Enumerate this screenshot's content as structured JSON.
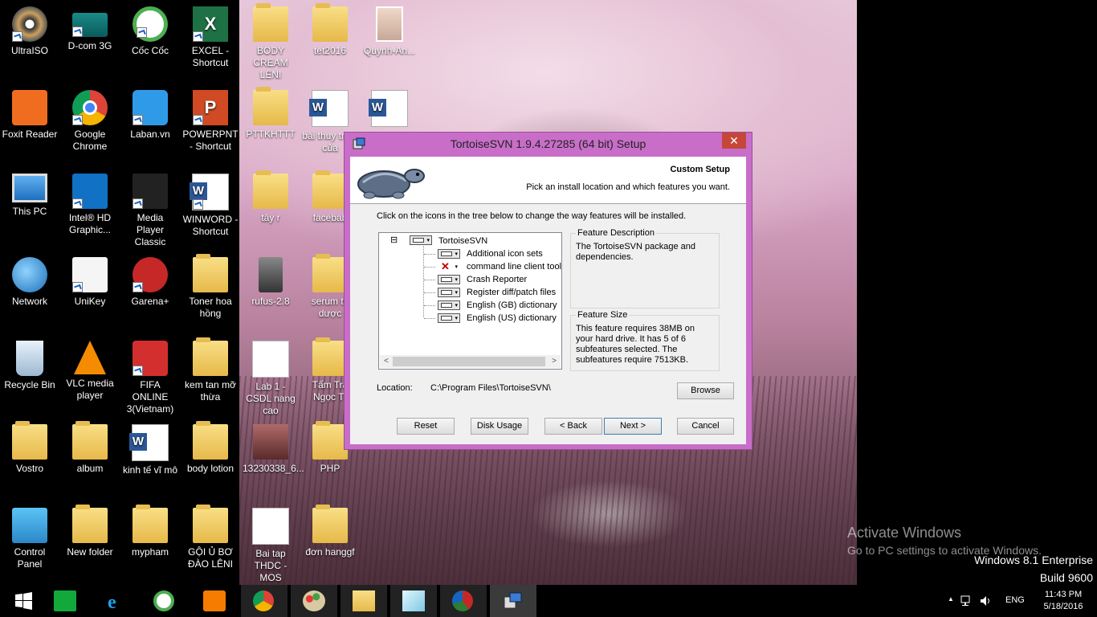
{
  "desktop_icons": [
    {
      "label": "UltraISO"
    },
    {
      "label": "D-com 3G"
    },
    {
      "label": "Cốc Cốc"
    },
    {
      "label": "EXCEL - Shortcut"
    },
    {
      "label": "BODY CREAM LÊNI"
    },
    {
      "label": "tet2016"
    },
    {
      "label": "Quynh-An..."
    },
    {
      "label": "Foxit Reader"
    },
    {
      "label": "Google Chrome"
    },
    {
      "label": "Laban.vn"
    },
    {
      "label": "POWERPNT - Shortcut"
    },
    {
      "label": "PTTKHTTT"
    },
    {
      "label": "bài thuy trình của"
    },
    {
      "label": ""
    },
    {
      "label": "This PC"
    },
    {
      "label": "Intel® HD Graphic..."
    },
    {
      "label": "Media Player Classic"
    },
    {
      "label": "WINWORD - Shortcut"
    },
    {
      "label": "tây r"
    },
    {
      "label": "facebab"
    },
    {
      "label": "Network"
    },
    {
      "label": "UniKey"
    },
    {
      "label": "Garena+"
    },
    {
      "label": "Toner hoa hồng"
    },
    {
      "label": "rufus-2.8"
    },
    {
      "label": "serum th dược"
    },
    {
      "label": "Recycle Bin"
    },
    {
      "label": "VLC media player"
    },
    {
      "label": "FIFA ONLINE 3(Vietnam)"
    },
    {
      "label": "kem tan mỡ thừa"
    },
    {
      "label": "Lab 1 - CSDL nang cao"
    },
    {
      "label": "Tấm Trả Ngọc Tr"
    },
    {
      "label": "Vostro"
    },
    {
      "label": "album"
    },
    {
      "label": "kinh tế vĩ mô"
    },
    {
      "label": "body lotion"
    },
    {
      "label": "13230338_6..."
    },
    {
      "label": "PHP"
    },
    {
      "label": "Control Panel"
    },
    {
      "label": "New folder"
    },
    {
      "label": "mypham"
    },
    {
      "label": "GỘI Ủ BƠ ĐÀO LÊNI"
    },
    {
      "label": "Bai tap THDC - MOS"
    },
    {
      "label": "đơn hanggf"
    }
  ],
  "dialog": {
    "title": "TortoiseSVN 1.9.4.27285 (64 bit) Setup",
    "close_label": "✕",
    "banner_title": "Custom Setup",
    "banner_subtitle": "Pick an install location and which features you want.",
    "instruction": "Click on the icons in the tree below to change the way features will be installed.",
    "tree": {
      "root": "TortoiseSVN",
      "root_expander": "⊟",
      "children": [
        {
          "label": "Additional icon sets",
          "state": "install"
        },
        {
          "label": "command line client tools",
          "state": "excluded"
        },
        {
          "label": "Crash Reporter",
          "state": "install"
        },
        {
          "label": "Register diff/patch files",
          "state": "install"
        },
        {
          "label": "English (GB) dictionary",
          "state": "install"
        },
        {
          "label": "English (US) dictionary",
          "state": "install"
        }
      ],
      "scroll_left": "<",
      "scroll_right": ">"
    },
    "feature_description_legend": "Feature Description",
    "feature_description": "The TortoiseSVN package and dependencies.",
    "feature_size_legend": "Feature Size",
    "feature_size": "This feature requires 38MB on your hard drive. It has 5 of 6 subfeatures selected. The subfeatures require 7513KB.",
    "location_label": "Location:",
    "location_value": "C:\\Program Files\\TortoiseSVN\\",
    "browse_label": "Browse",
    "reset_label": "Reset",
    "disk_usage_label": "Disk Usage",
    "back_label": "< Back",
    "next_label": "Next >",
    "cancel_label": "Cancel"
  },
  "watermark": {
    "line1": "Activate Windows",
    "line2": "Go to PC settings to activate Windows.",
    "edition": "Windows 8.1 Enterprise",
    "build": "Build 9600"
  },
  "tray": {
    "language": "ENG",
    "time": "11:43 PM",
    "date": "5/18/2016",
    "up_arrow": "▲"
  },
  "colors": {
    "dialog_frame": "#c86ec8",
    "close_button": "#c7463a",
    "taskbar": "#000000"
  }
}
